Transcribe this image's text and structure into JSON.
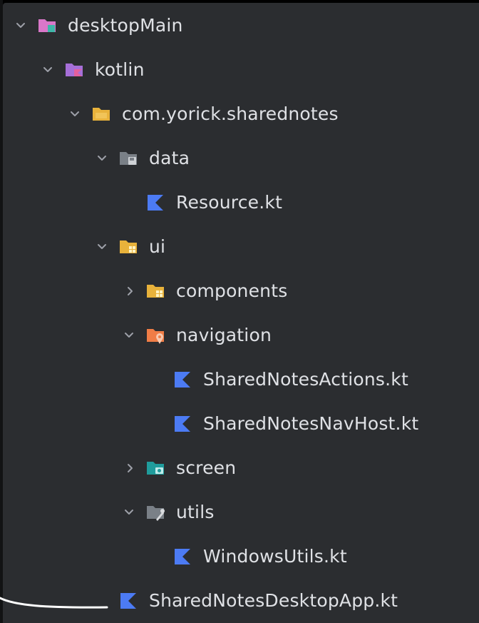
{
  "project_tree": {
    "items": [
      {
        "label": "desktopMain",
        "expanded": true,
        "icon": "source-root-folder-icon"
      },
      {
        "label": "kotlin",
        "expanded": true,
        "icon": "kotlin-source-folder-icon"
      },
      {
        "label": "com.yorick.sharednotes",
        "expanded": true,
        "icon": "package-folder-icon"
      },
      {
        "label": "data",
        "expanded": true,
        "icon": "data-folder-icon"
      },
      {
        "label": "Resource.kt",
        "icon": "kotlin-file-icon"
      },
      {
        "label": "ui",
        "expanded": true,
        "icon": "ui-folder-icon"
      },
      {
        "label": "components",
        "expanded": false,
        "icon": "ui-folder-icon"
      },
      {
        "label": "navigation",
        "expanded": true,
        "icon": "navigation-folder-icon"
      },
      {
        "label": "SharedNotesActions.kt",
        "icon": "kotlin-file-icon"
      },
      {
        "label": "SharedNotesNavHost.kt",
        "icon": "kotlin-file-icon"
      },
      {
        "label": "screen",
        "expanded": false,
        "icon": "screen-folder-icon"
      },
      {
        "label": "utils",
        "expanded": true,
        "icon": "utils-folder-icon"
      },
      {
        "label": "WindowsUtils.kt",
        "icon": "kotlin-file-icon"
      },
      {
        "label": "SharedNotesDesktopApp.kt",
        "icon": "kotlin-file-icon"
      }
    ]
  },
  "colors": {
    "panel_background": "#2b2d30",
    "text": "#dfe1e5",
    "chevron": "#9da0a8",
    "kotlin_icon": "#4c7bf4",
    "folder_yellow": "#e8b23b",
    "folder_pink": "#d977c9",
    "folder_orange": "#f07d46",
    "folder_teal": "#1f9c9c",
    "folder_grey": "#7a8087"
  }
}
